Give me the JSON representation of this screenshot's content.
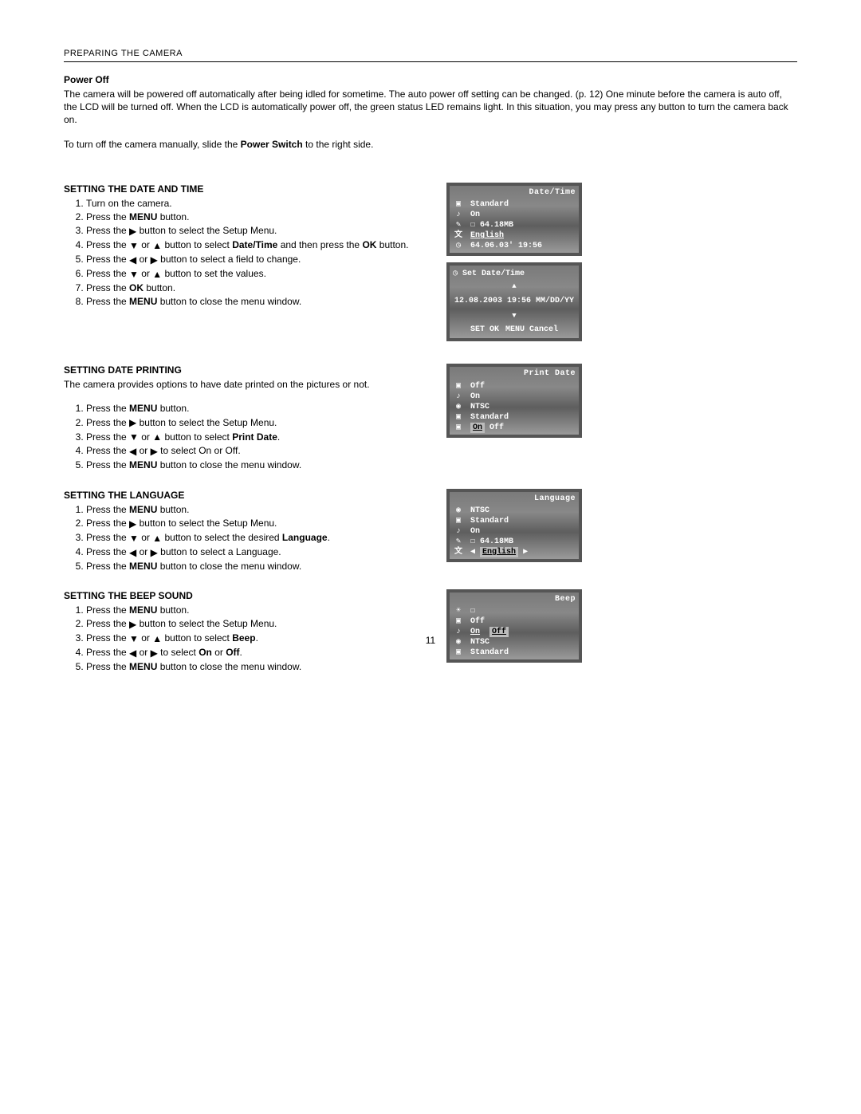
{
  "header": "PREPARING THE CAMERA",
  "page_number": "11",
  "power_off": {
    "title": "Power Off",
    "p1a": "The camera will be powered off automatically after being idled for sometime. The auto power off setting can be changed. (p. 12) One minute before the camera is auto off, the LCD will be turned off. When the LCD is automatically power off, the green status LED remains light. In this situation, you may press any button to turn the camera back on.",
    "p2a": "To turn off the camera manually, slide the ",
    "p2b": "Power Switch",
    "p2c": " to the right side."
  },
  "datetime": {
    "heading": "SETTING THE DATE AND TIME",
    "s1": "Turn on the camera.",
    "s2a": "Press the ",
    "s2b": "MENU",
    "s2c": " button.",
    "s3a": "Press the ",
    "s3b": " button to select the Setup Menu.",
    "s4a": "Press the ",
    "s4b": " or ",
    "s4c": " button to select ",
    "s4d": "Date/Time",
    "s4e": " and then press the ",
    "s4f": "OK",
    "s4g": " button.",
    "s5a": "Press the ",
    "s5b": " or ",
    "s5c": " button to select a field to change.",
    "s6a": "Press the ",
    "s6b": " or ",
    "s6c": " button to set the values.",
    "s7a": "Press the ",
    "s7b": "OK",
    "s7c": " button.",
    "s8a": "Press the ",
    "s8b": "MENU",
    "s8c": " button to close the menu window."
  },
  "printdate": {
    "heading": "SETTING DATE PRINTING",
    "intro": "The camera provides options to have date printed on the pictures or not.",
    "s1a": "Press the ",
    "s1b": "MENU",
    "s1c": " button.",
    "s2a": "Press the ",
    "s2b": " button to select the Setup Menu.",
    "s3a": "Press the ",
    "s3b": " or ",
    "s3c": " button to select ",
    "s3d": "Print Date",
    "s3e": ".",
    "s4a": "Press the ",
    "s4b": " or ",
    "s4c": " to select On or Off.",
    "s5a": "Press the ",
    "s5b": "MENU",
    "s5c": " button to close the menu window."
  },
  "language": {
    "heading": "SETTING THE LANGUAGE",
    "s1a": "Press the ",
    "s1b": "MENU",
    "s1c": " button.",
    "s2a": "Press the ",
    "s2b": " button to select the Setup Menu.",
    "s3a": "Press the ",
    "s3b": " or ",
    "s3c": " button to select the desired ",
    "s3d": "Language",
    "s3e": ".",
    "s4a": "Press the ",
    "s4b": " or ",
    "s4c": " button to select a Language.",
    "s5a": "Press the ",
    "s5b": "MENU",
    "s5c": " button to close the menu window."
  },
  "beep": {
    "heading": "SETTING THE BEEP SOUND",
    "s1a": "Press the ",
    "s1b": "MENU",
    "s1c": " button.",
    "s2a": "Press the ",
    "s2b": " button to select the Setup Menu.",
    "s3a": "Press the ",
    "s3b": " or ",
    "s3c": " button to select ",
    "s3d": "Beep",
    "s3e": ".",
    "s4a": "Press the ",
    "s4b": " or ",
    "s4c": " to select ",
    "s4d": "On",
    "s4e": " or ",
    "s4f": "Off",
    "s4g": ".",
    "s5a": "Press the ",
    "s5b": "MENU",
    "s5c": " button to close the menu window."
  },
  "shots": {
    "datetime_menu": {
      "title": "Date/Time",
      "rows": [
        "Standard",
        "On",
        "☐ 64.18MB",
        "English",
        "64.06.03' 19:56"
      ]
    },
    "set_datetime": {
      "title": "Set Date/Time",
      "value": "12.08.2003 19:56 MM/DD/YY",
      "ok": "SET OK",
      "cancel": "MENU Cancel"
    },
    "print_date": {
      "title": "Print Date",
      "rows": [
        "Off",
        "On",
        "NTSC",
        "Standard"
      ],
      "last_a": "On",
      "last_b": "Off"
    },
    "language_menu": {
      "title": "Language",
      "rows": [
        "NTSC",
        "Standard",
        "On",
        "☐ 64.18MB"
      ],
      "sel": "English"
    },
    "beep_menu": {
      "title": "Beep",
      "rows_top": [
        "☐",
        "Off"
      ],
      "on": "On",
      "off": "Off",
      "rows_bot": [
        "NTSC",
        "Standard"
      ]
    }
  }
}
